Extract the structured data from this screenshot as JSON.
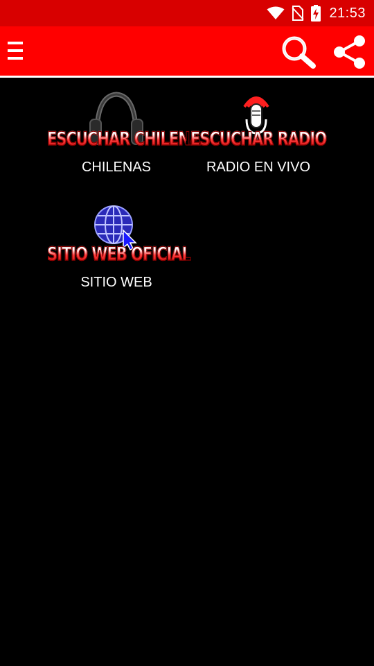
{
  "status_bar": {
    "time": "21:53",
    "icons": [
      "wifi-icon",
      "no-sim-icon",
      "battery-charging-icon"
    ]
  },
  "app_bar": {
    "menu_icon": "menu-icon",
    "search_icon": "search-icon",
    "share_icon": "share-icon",
    "color": "#ff0000"
  },
  "tiles": [
    {
      "banner": "ESCUCHAR CHILENAS",
      "label": "CHILENAS",
      "icon": "headphones-icon"
    },
    {
      "banner": "ESCUCHAR RADIO",
      "label": "RADIO EN VIVO",
      "icon": "microphone-icon"
    },
    {
      "banner": "SITIO WEB OFICIAL",
      "label": "SITIO WEB",
      "icon": "globe-icon"
    }
  ]
}
